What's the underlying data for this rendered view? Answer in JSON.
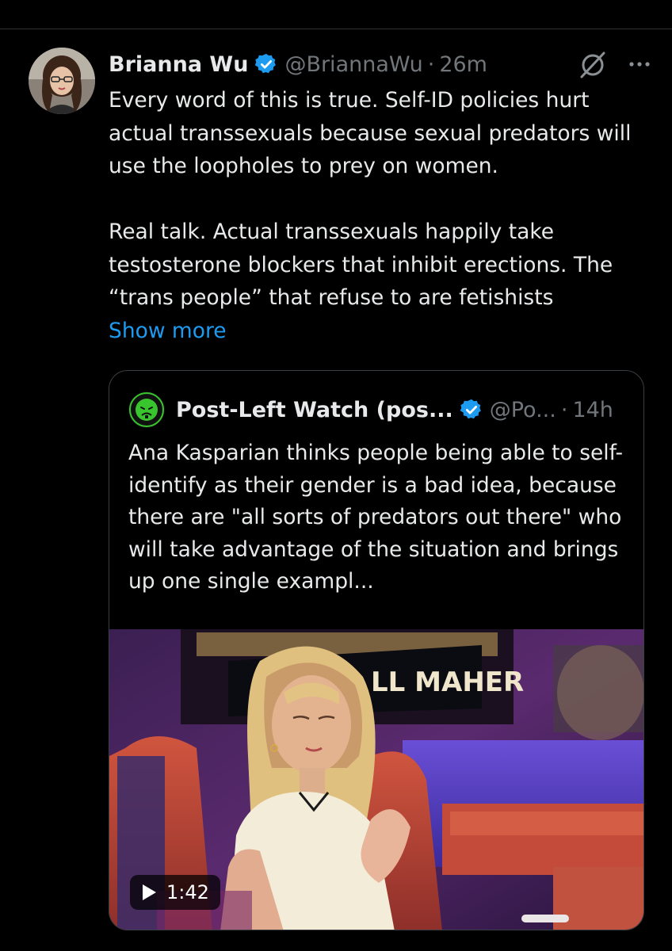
{
  "tweet": {
    "author_name": "Brianna Wu",
    "handle": "@BriannaWu",
    "separator": "·",
    "time": "26m",
    "paragraph1": "Every word of this is true. Self-ID policies hurt actual transsexuals because sexual predators will use the loopholes to prey on women.",
    "paragraph2": "Real talk. Actual transsexuals happily take testosterone blockers that inhibit erections. The “trans people” that refuse to are fetishists",
    "show_more": "Show more",
    "icons": {
      "verified": "verified-badge-icon",
      "grok": "grok-icon",
      "more": "more-icon"
    }
  },
  "quote": {
    "author_name": "Post-Left Watch (pos...",
    "handle": "@Po...",
    "separator": "·",
    "time": "14h",
    "text": "Ana Kasparian thinks people being able to self-identify as their gender is a bad idea, because there are \"all sorts of predators out there\" who will take advantage of the situation and brings up one single exampl...",
    "media": {
      "sign_text": "LL MAHER",
      "duration": "1:42",
      "icon": "play-icon"
    }
  },
  "colors": {
    "background": "#000000",
    "text": "#e7e9ea",
    "muted": "#71767b",
    "link": "#1d9bf0",
    "verified": "#1d9bf0",
    "border": "#3a3f44"
  }
}
